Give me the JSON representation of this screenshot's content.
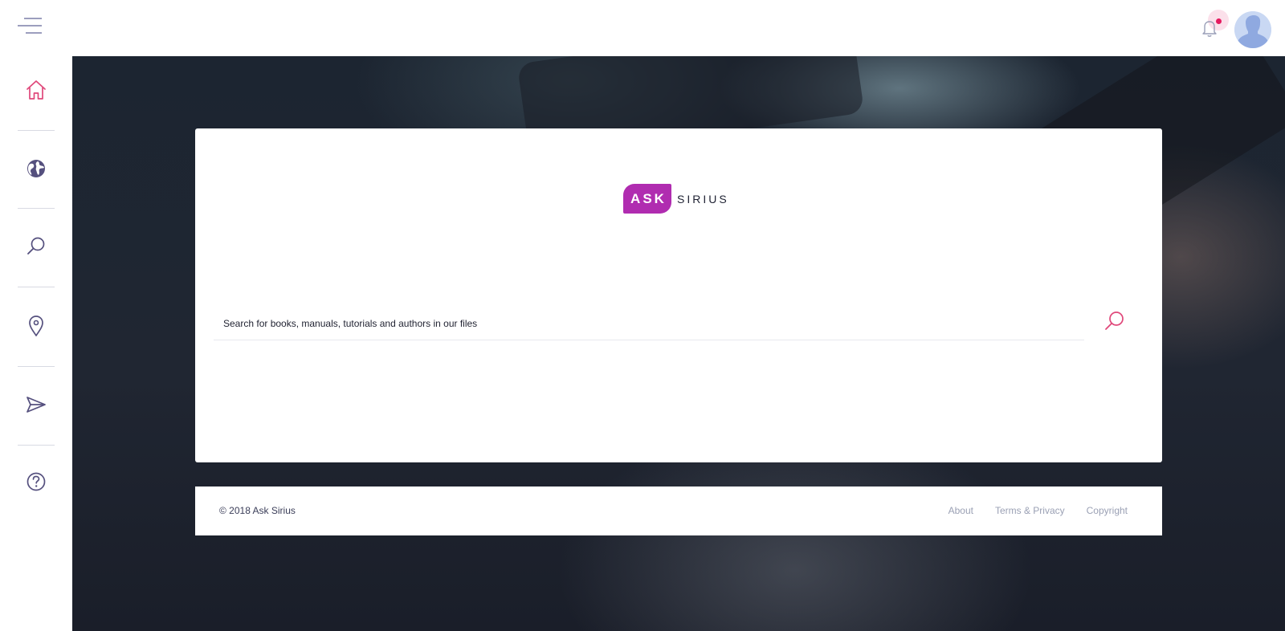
{
  "colors": {
    "accent_pink": "#e0487a",
    "icon_purple": "#55507e",
    "brand_magenta": "#b02cb0",
    "notification_dot": "#e5195f"
  },
  "header": {
    "menu_icon": "hamburger-menu-icon",
    "notification_icon": "bell-icon",
    "avatar_icon": "user-avatar"
  },
  "sidebar": {
    "items": [
      {
        "icon": "home-icon",
        "active": true
      },
      {
        "icon": "globe-icon",
        "active": false
      },
      {
        "icon": "search-icon",
        "active": false
      },
      {
        "icon": "map-pin-icon",
        "active": false
      },
      {
        "icon": "send-icon",
        "active": false
      },
      {
        "icon": "help-icon",
        "active": false
      }
    ]
  },
  "logo": {
    "part1": "ASK",
    "part2": "SIRIUS"
  },
  "search": {
    "placeholder": "Search for books, manuals, tutorials and authors in our files",
    "value": ""
  },
  "footer": {
    "copyright": "© 2018 Ask Sirius",
    "links": [
      "About",
      "Terms & Privacy",
      "Copyright"
    ]
  }
}
